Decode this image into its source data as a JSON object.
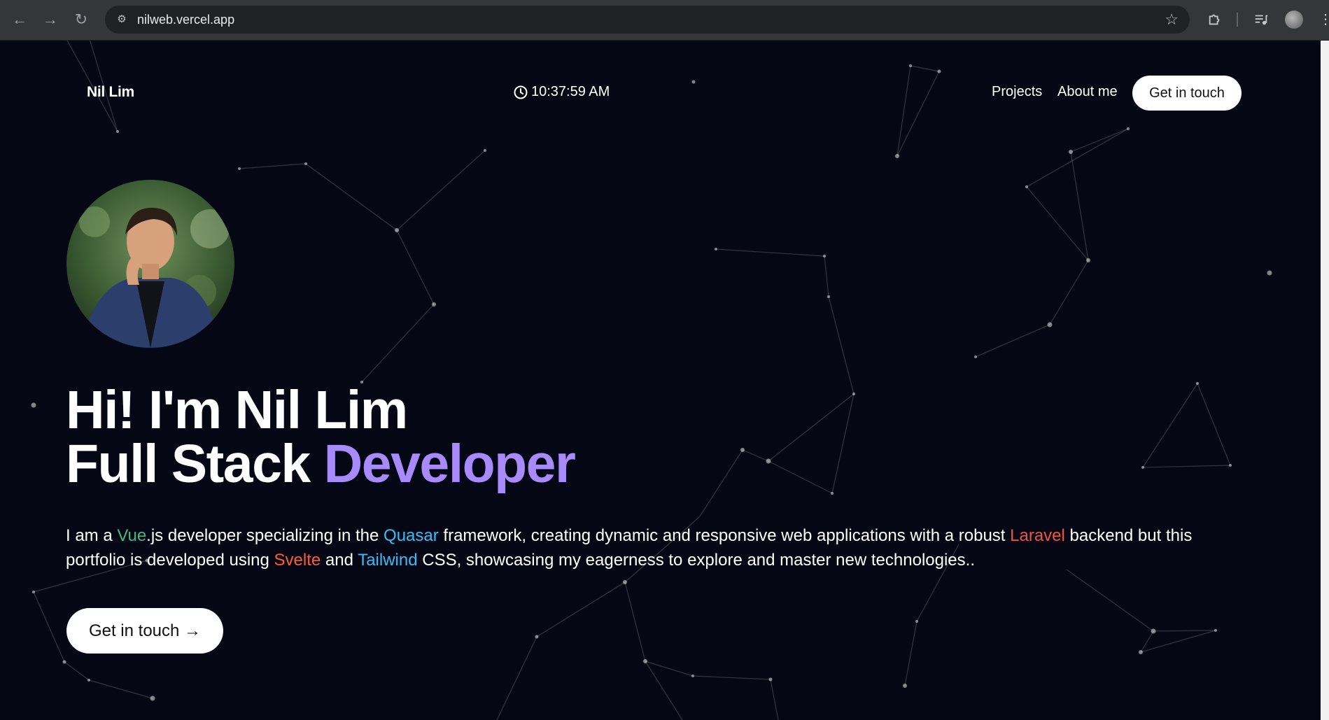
{
  "browser": {
    "url": "nilweb.vercel.app",
    "icons": {
      "back": "arrow-back-icon",
      "forward": "arrow-forward-icon",
      "reload": "reload-icon",
      "site_info": "site-info-icon",
      "bookmark": "star-icon",
      "extensions": "puzzle-icon",
      "media": "media-queue-icon",
      "profile": "profile-avatar-icon",
      "menu": "kebab-menu-icon"
    }
  },
  "header": {
    "logo": "Nil Lim",
    "time": "10:37:59 AM",
    "nav": [
      {
        "label": "Projects"
      },
      {
        "label": "About me"
      }
    ],
    "cta": "Get in touch"
  },
  "hero": {
    "headline_line1": "Hi! I'm Nil Lim",
    "headline_line2_white": "Full Stack",
    "headline_line2_accent": "Developer",
    "intro": {
      "t1": "I am a ",
      "vue": "Vue",
      "t2": ".js developer specializing in the ",
      "quasar": "Quasar",
      "t3": " framework, creating dynamic and responsive web applications with a robust ",
      "laravel": "Laravel",
      "t4": " backend but this portfolio is developed using ",
      "svelte": "Svelte",
      "t5": " and ",
      "tailwind": "Tailwind",
      "t6": " CSS, showcasing my eagerness to explore and master new technologies.."
    },
    "cta": "Get in touch →"
  },
  "colors": {
    "background": "#050814",
    "accent": "#a78bfa",
    "vue": "#42b883",
    "quasar": "#38bdf8",
    "laravel": "#f05340",
    "svelte": "#ff5a36",
    "tailwind": "#38bdf8"
  }
}
